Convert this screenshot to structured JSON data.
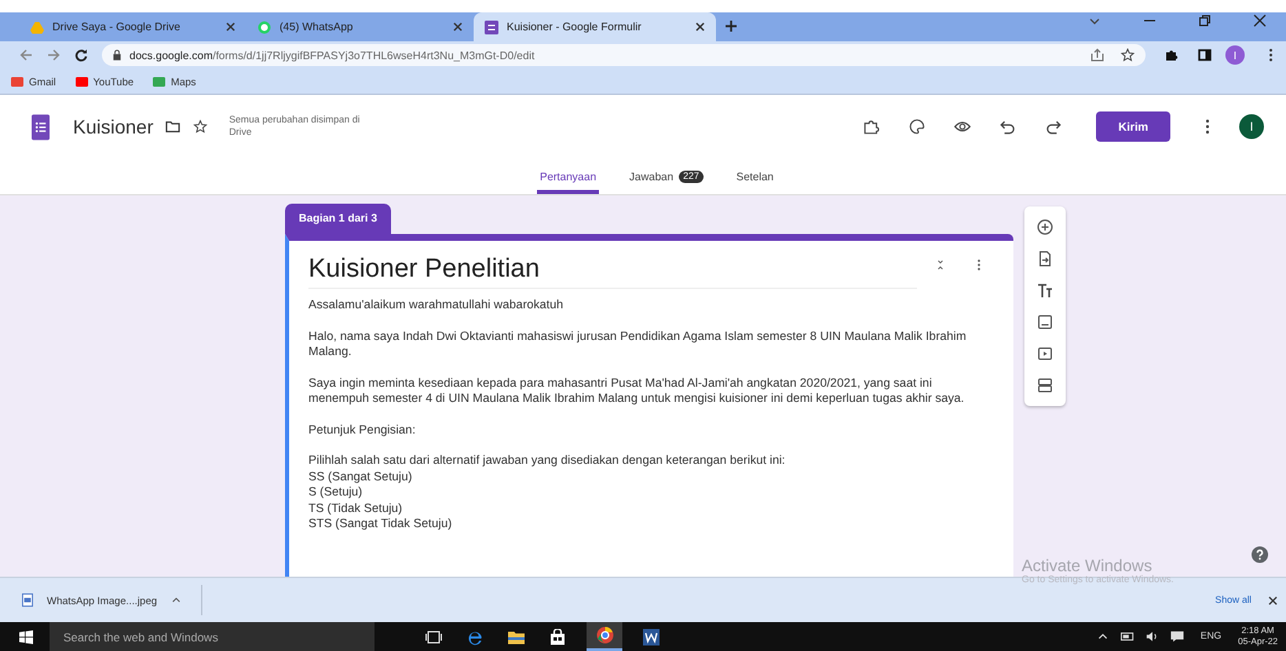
{
  "browser": {
    "tabs": [
      {
        "title": "Drive Saya - Google Drive",
        "kind": "drive",
        "selected": false
      },
      {
        "title": "(45) WhatsApp",
        "kind": "whatsapp",
        "selected": false
      },
      {
        "title": "Kuisioner - Google Formulir",
        "kind": "forms",
        "selected": true
      }
    ],
    "url_host": "docs.google.com",
    "url_path": "/forms/d/1jj7RljygifBFPASYj3o7THL6wseH4rt3Nu_M3mGt-D0/edit",
    "profile_initial": "I",
    "bookmarks": [
      {
        "label": "Gmail",
        "kind": "gmail"
      },
      {
        "label": "YouTube",
        "kind": "youtube"
      },
      {
        "label": "Maps",
        "kind": "maps"
      }
    ]
  },
  "form_header": {
    "title": "Kuisioner",
    "save_status": "Semua perubahan disimpan di Drive",
    "send_button": "Kirim",
    "avatar_initial": "I"
  },
  "form_tabs": [
    {
      "label": "Pertanyaan",
      "selected": true
    },
    {
      "label": "Jawaban",
      "badge": "227",
      "selected": false
    },
    {
      "label": "Setelan",
      "selected": false
    }
  ],
  "section": {
    "label": "Bagian 1 dari 3",
    "title": "Kuisioner Penelitian",
    "paragraphs": [
      [
        "Assalamu'alaikum warahmatullahi wabarokatuh"
      ],
      [
        "Halo, nama saya Indah Dwi Oktavianti mahasiswi jurusan Pendidikan Agama Islam semester 8 UIN Maulana Malik Ibrahim Malang."
      ],
      [
        "Saya ingin meminta kesediaan kepada para mahasantri Pusat Ma'had Al-Jami'ah angkatan 2020/2021, yang saat ini menempuh semester 4 di UIN Maulana Malik Ibrahim Malang untuk mengisi kuisioner ini demi keperluan tugas akhir saya."
      ],
      [
        "Petunjuk Pengisian:"
      ],
      [
        "Pilihlah salah satu dari alternatif jawaban yang disediakan dengan keterangan berikut ini:",
        "SS (Sangat Setuju)",
        "S (Setuju)",
        "TS (Tidak Setuju)",
        "STS (Sangat Tidak Setuju)"
      ]
    ]
  },
  "activation_notice": {
    "title": "Activate Windows",
    "subtitle": "Go to Settings to activate Windows."
  },
  "downloads": {
    "file": "WhatsApp Image....jpeg",
    "show_all": "Show all"
  },
  "taskbar": {
    "search_placeholder": "Search the web and Windows",
    "time": "2:18 AM",
    "date": "05-Apr-22",
    "language": "ENG"
  }
}
